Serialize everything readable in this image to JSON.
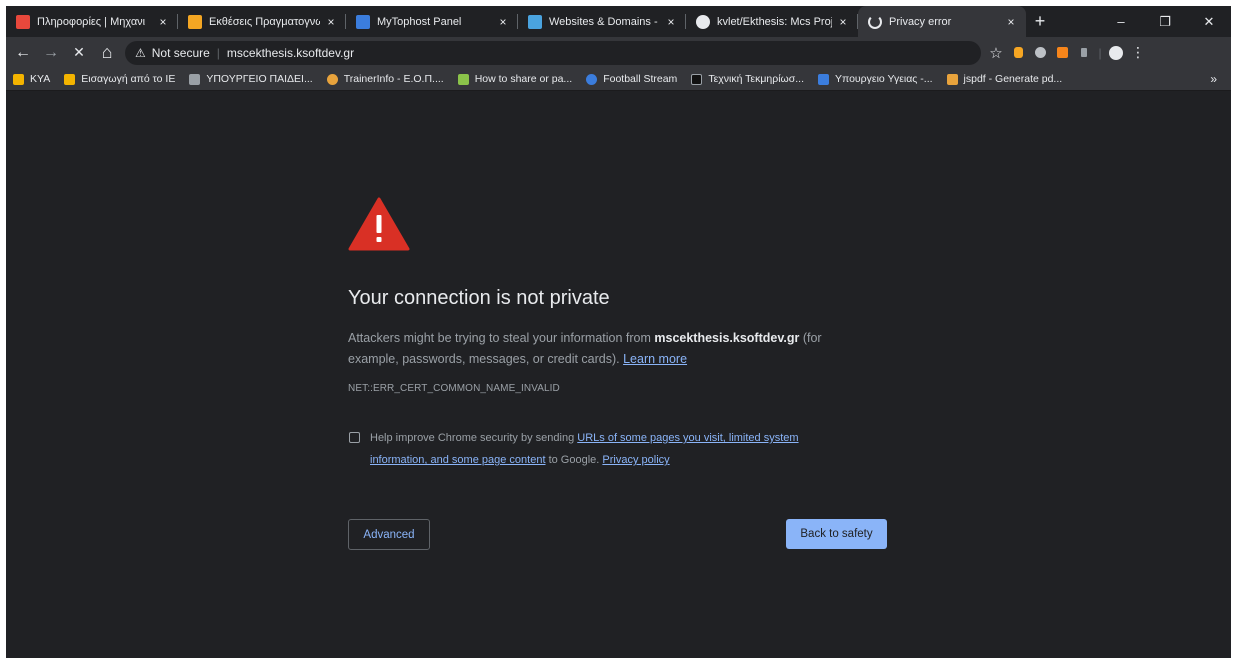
{
  "colors": {
    "window_bg": "#202124",
    "toolbar_bg": "#35363a",
    "text_primary": "#e8eaed",
    "text_secondary": "#9aa0a6",
    "link": "#8ab4f8",
    "warning_red": "#d93025",
    "primary_button": "#8ab4f8"
  },
  "tabs": [
    {
      "title": "Πληροφορίες | Μηχανι",
      "favicon": "red-building-icon",
      "color": "#e8483c",
      "close": "×"
    },
    {
      "title": "Εκθέσεις Πραγματογνω",
      "favicon": "grid-app-icon",
      "color": "#f4a623",
      "close": "×"
    },
    {
      "title": "MyTophost Panel",
      "favicon": "panel-icon",
      "color": "#3b7ddd",
      "close": "×"
    },
    {
      "title": "Websites & Domains -",
      "favicon": "plesk-icon",
      "color": "#4aa3df",
      "close": "×"
    },
    {
      "title": "kvlet/Ekthesis: Mcs Proj",
      "favicon": "github-icon",
      "color": "#e8eaed",
      "close": "×"
    },
    {
      "title": "Privacy error",
      "favicon": "loading-spinner-icon",
      "color": "#e8eaed",
      "close": "×",
      "active": true
    }
  ],
  "new_tab_symbol": "+",
  "window_controls": {
    "minimize": "–",
    "restore": "❐",
    "close": "✕"
  },
  "toolbar": {
    "back": "←",
    "forward": "→",
    "stop": "✕",
    "home": "⌂",
    "security_label": "Not secure",
    "security_icon": "⚠",
    "separator": "|",
    "url": "mscekthesis.ksoftdev.gr",
    "star": "☆",
    "menu": "⋮",
    "profile": "●"
  },
  "bookmarks": [
    {
      "label": "KYA",
      "icon": "folder-icon",
      "color": "#f4b400"
    },
    {
      "label": "Εισαγωγή από το IE",
      "icon": "folder-icon",
      "color": "#f4b400"
    },
    {
      "label": "ΥΠΟΥΡΓΕΙΟ ΠΑΙΔΕΙ...",
      "icon": "ministry-icon",
      "color": "#9aa0a6"
    },
    {
      "label": "TrainerInfo - Ε.Ο.Π....",
      "icon": "runner-icon",
      "color": "#e8a33c"
    },
    {
      "label": "How to share or pa...",
      "icon": "b-icon",
      "color": "#8bc34a"
    },
    {
      "label": "Football Stream",
      "icon": "stream-icon",
      "color": "#3b7ddd"
    },
    {
      "label": "Τεχνική Τεκμηρίωσ...",
      "icon": "monitor-icon",
      "color": "#202124"
    },
    {
      "label": "Υπουργειο Υγειας -...",
      "icon": "health-icon",
      "color": "#3b7ddd"
    },
    {
      "label": "jspdf - Generate pd...",
      "icon": "pdf-icon",
      "color": "#e8a33c"
    }
  ],
  "bookmarks_more": "»",
  "error_page": {
    "heading": "Your connection is not private",
    "desc_prefix": "Attackers might be trying to steal your information from ",
    "desc_domain": "mscekthesis.ksoftdev.gr",
    "desc_suffix": " (for example, passwords, messages, or credit cards). ",
    "learn_more": "Learn more",
    "error_code": "NET::ERR_CERT_COMMON_NAME_INVALID",
    "optin_prefix": "Help improve Chrome security by sending ",
    "optin_link": "URLs of some pages you visit, limited system information, and some page content",
    "optin_mid": " to Google. ",
    "privacy_policy": "Privacy policy",
    "advanced_button": "Advanced",
    "back_button": "Back to safety"
  }
}
